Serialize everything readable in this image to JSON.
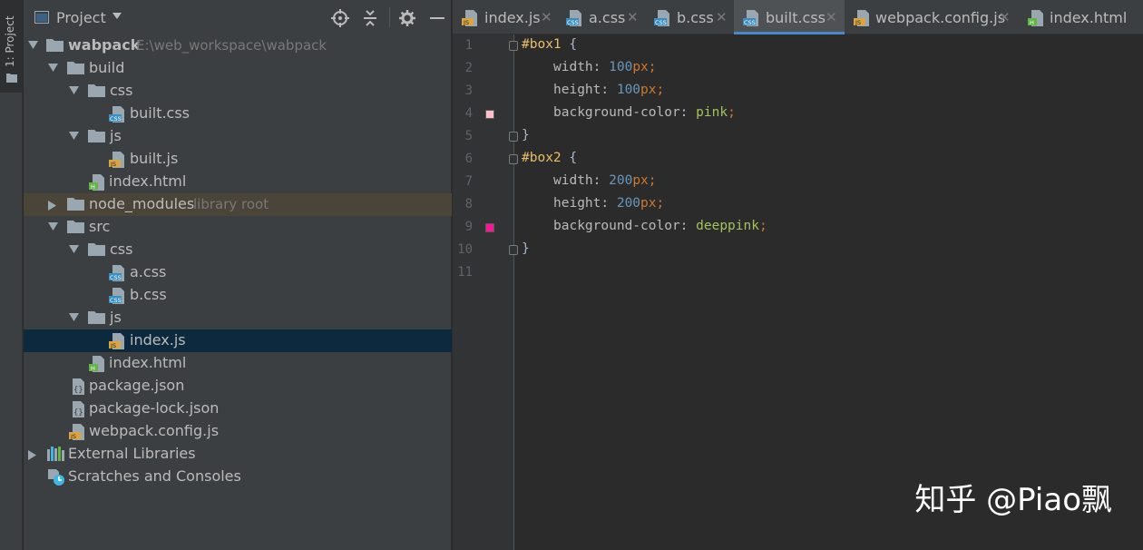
{
  "strip": {
    "label": "1: Project"
  },
  "project": {
    "title": "Project",
    "tree": [
      {
        "label": "wabpack",
        "hint": "E:\\web_workspace\\wabpack",
        "bold": true
      },
      {
        "label": "build"
      },
      {
        "label": "css"
      },
      {
        "label": "built.css"
      },
      {
        "label": "js"
      },
      {
        "label": "built.js"
      },
      {
        "label": "index.html"
      },
      {
        "label": "node_modules",
        "hint": "library root"
      },
      {
        "label": "src"
      },
      {
        "label": "css"
      },
      {
        "label": "a.css"
      },
      {
        "label": "b.css"
      },
      {
        "label": "js"
      },
      {
        "label": "index.js"
      },
      {
        "label": "index.html"
      },
      {
        "label": "package.json"
      },
      {
        "label": "package-lock.json"
      },
      {
        "label": "webpack.config.js"
      },
      {
        "label": "External Libraries"
      },
      {
        "label": "Scratches and Consoles"
      }
    ]
  },
  "tabs": [
    {
      "label": "index.js",
      "icon": "js-file-icon"
    },
    {
      "label": "a.css",
      "icon": "css-file-icon"
    },
    {
      "label": "b.css",
      "icon": "css-file-icon"
    },
    {
      "label": "built.css",
      "icon": "css-file-icon",
      "active": true
    },
    {
      "label": "webpack.config.js",
      "icon": "js-file-icon"
    },
    {
      "label": "index.html",
      "icon": "html-file-icon"
    }
  ],
  "editor": {
    "line_numbers": [
      "1",
      "2",
      "3",
      "4",
      "5",
      "6",
      "7",
      "8",
      "9",
      "10",
      "11"
    ],
    "swatch_colors": {
      "pink": "#ffc0cb",
      "deeppink": "#ff1493"
    },
    "code": {
      "l1_selector": "#box1",
      "l1_brace": " {",
      "l2_prop": "width: ",
      "l2_num": "100",
      "l2_unit": "px",
      "l2_semi": ";",
      "l3_prop": "height: ",
      "l3_num": "100",
      "l3_unit": "px",
      "l3_semi": ";",
      "l4_prop": "background-color: ",
      "l4_val": "pink",
      "l4_semi": ";",
      "l5_brace": "}",
      "l6_selector": "#box2",
      "l6_brace": " {",
      "l7_prop": "width: ",
      "l7_num": "200",
      "l7_unit": "px",
      "l7_semi": ";",
      "l8_prop": "height: ",
      "l8_num": "200",
      "l8_unit": "px",
      "l8_semi": ";",
      "l9_prop": "background-color: ",
      "l9_val": "deeppink",
      "l9_semi": ";",
      "l10_brace": "}"
    }
  },
  "watermark": "知乎 @Piao飘"
}
